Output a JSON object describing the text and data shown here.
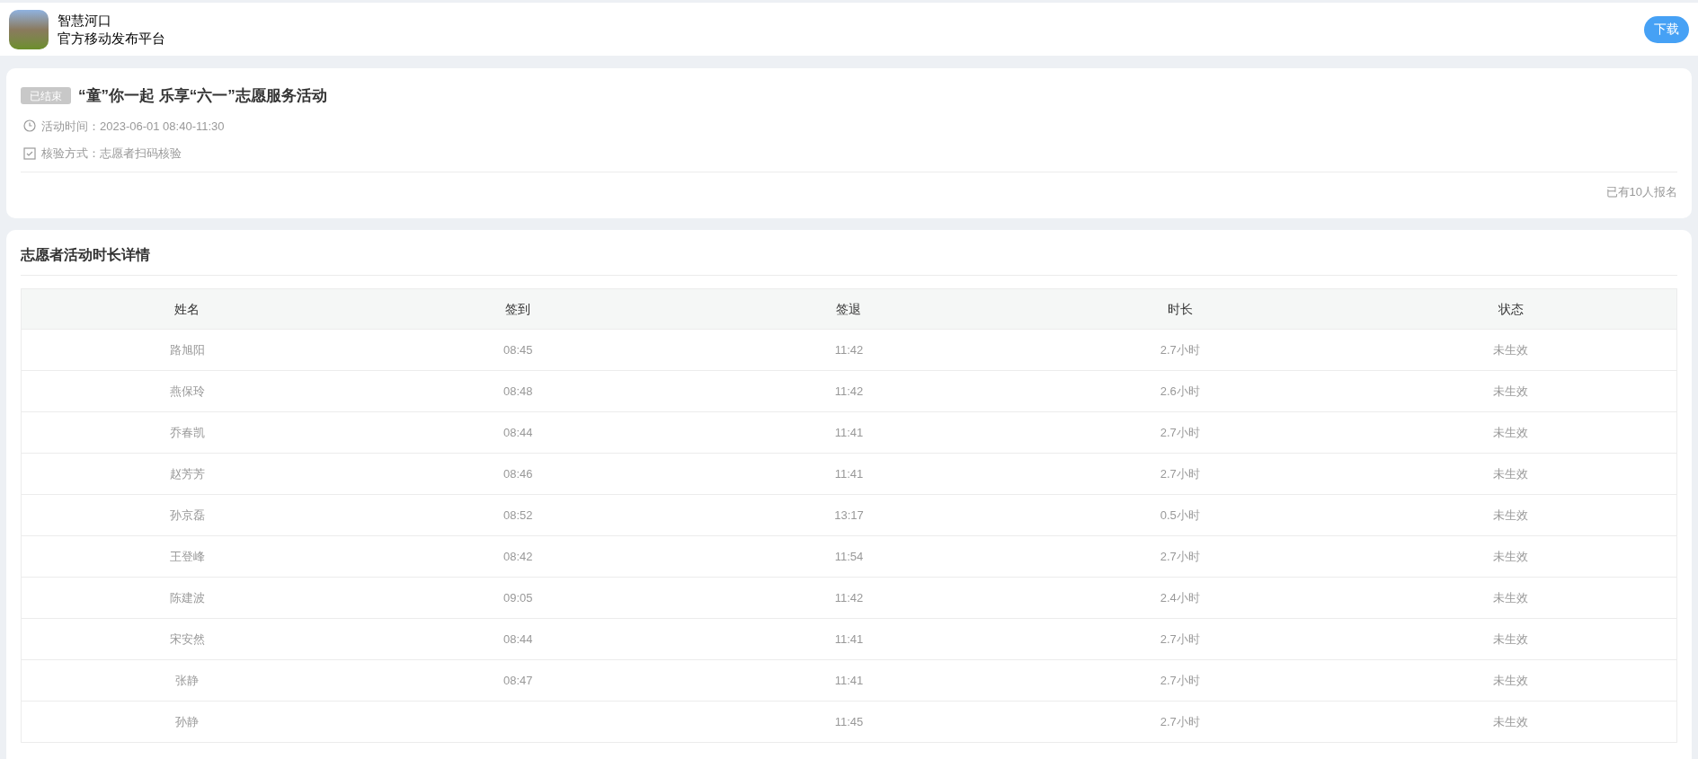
{
  "header": {
    "app_name": "智慧河口",
    "subtitle": "官方移动发布平台",
    "download_button": "下载"
  },
  "activity": {
    "status_badge": "已结束",
    "title": "“童”你一起 乐享“六一”志愿服务活动",
    "details": [
      {
        "kind": "time",
        "text": "活动时间：2023-06-01 08:40-11:30"
      },
      {
        "kind": "check",
        "text": "核验方式：志愿者扫码核验"
      }
    ],
    "signup_count": "已有10人报名"
  },
  "detail_section": {
    "title": "志愿者活动时长详情",
    "table": {
      "columns": [
        "姓名",
        "签到",
        "签退",
        "时长",
        "状态"
      ],
      "rows": [
        [
          "路旭阳",
          "08:45",
          "11:42",
          "2.7小时",
          "未生效"
        ],
        [
          "燕保玲",
          "08:48",
          "11:42",
          "2.6小时",
          "未生效"
        ],
        [
          "乔春凯",
          "08:44",
          "11:41",
          "2.7小时",
          "未生效"
        ],
        [
          "赵芳芳",
          "08:46",
          "11:41",
          "2.7小时",
          "未生效"
        ],
        [
          "孙京磊",
          "08:52",
          "13:17",
          "0.5小时",
          "未生效"
        ],
        [
          "王登峰",
          "08:42",
          "11:54",
          "2.7小时",
          "未生效"
        ],
        [
          "陈建波",
          "09:05",
          "11:42",
          "2.4小时",
          "未生效"
        ],
        [
          "宋安然",
          "08:44",
          "11:41",
          "2.7小时",
          "未生效"
        ],
        [
          "张静",
          "08:47",
          "11:41",
          "2.7小时",
          "未生效"
        ],
        [
          "孙静",
          "",
          "11:45",
          "2.7小时",
          "未生效"
        ]
      ]
    }
  }
}
